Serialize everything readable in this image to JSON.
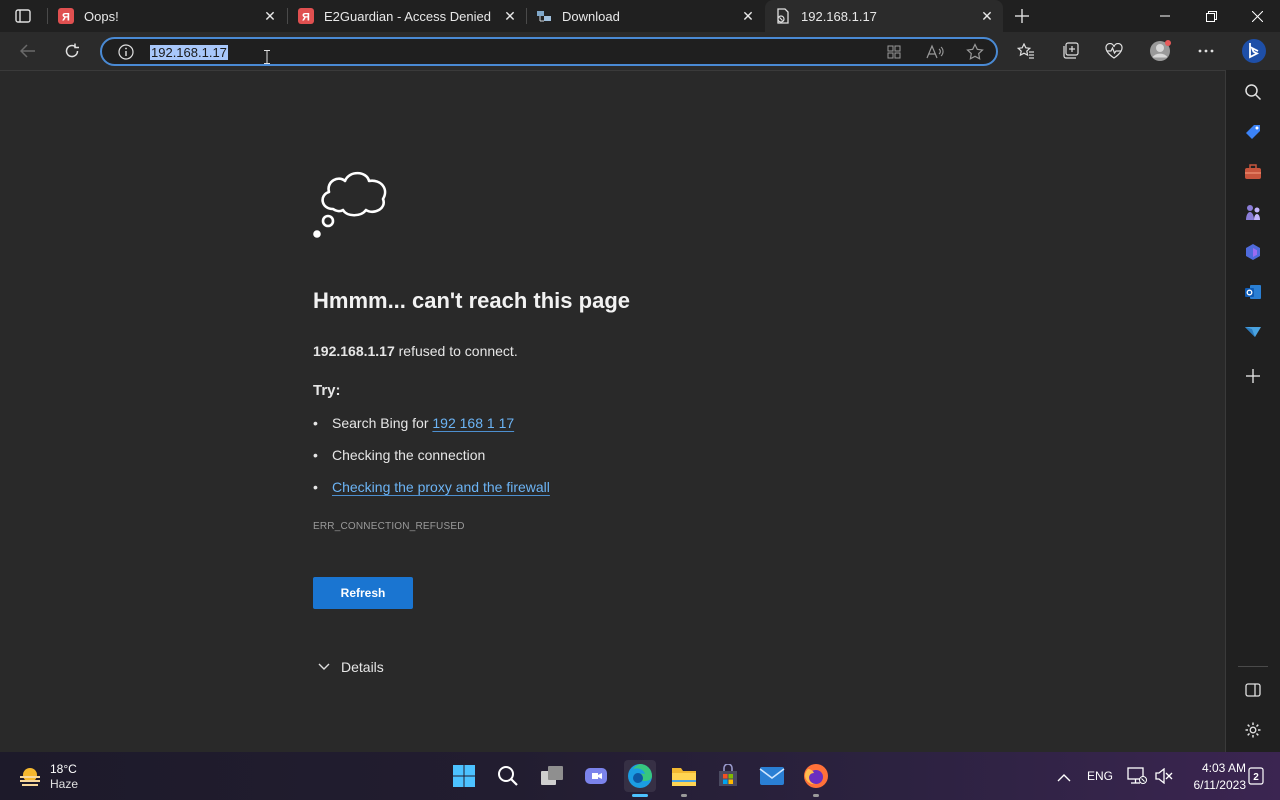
{
  "tabs": [
    {
      "title": "Oops!",
      "favicon": "yandex-icon"
    },
    {
      "title": "E2Guardian - Access Denied",
      "favicon": "yandex-icon"
    },
    {
      "title": "Download",
      "favicon": "network-icon"
    },
    {
      "title": "192.168.1.17",
      "favicon": "error-page-icon",
      "active": true
    }
  ],
  "address_bar": {
    "url": "192.168.1.17"
  },
  "error_page": {
    "title": "Hmmm... can't reach this page",
    "host": "192.168.1.17",
    "refused_text": " refused to connect.",
    "try_label": "Try:",
    "search_prefix": "Search Bing for ",
    "search_link": "192 168 1 17",
    "check_connection": "Checking the connection",
    "check_proxy": "Checking the proxy and the firewall",
    "error_code": "ERR_CONNECTION_REFUSED",
    "refresh_label": "Refresh",
    "details_label": "Details"
  },
  "taskbar": {
    "weather_temp": "18°C",
    "weather_cond": "Haze",
    "language": "ENG",
    "time": "4:03 AM",
    "date": "6/11/2023"
  },
  "colors": {
    "accent": "#1a75d1",
    "link": "#6cb4f5",
    "selection": "#a8c7fa"
  }
}
